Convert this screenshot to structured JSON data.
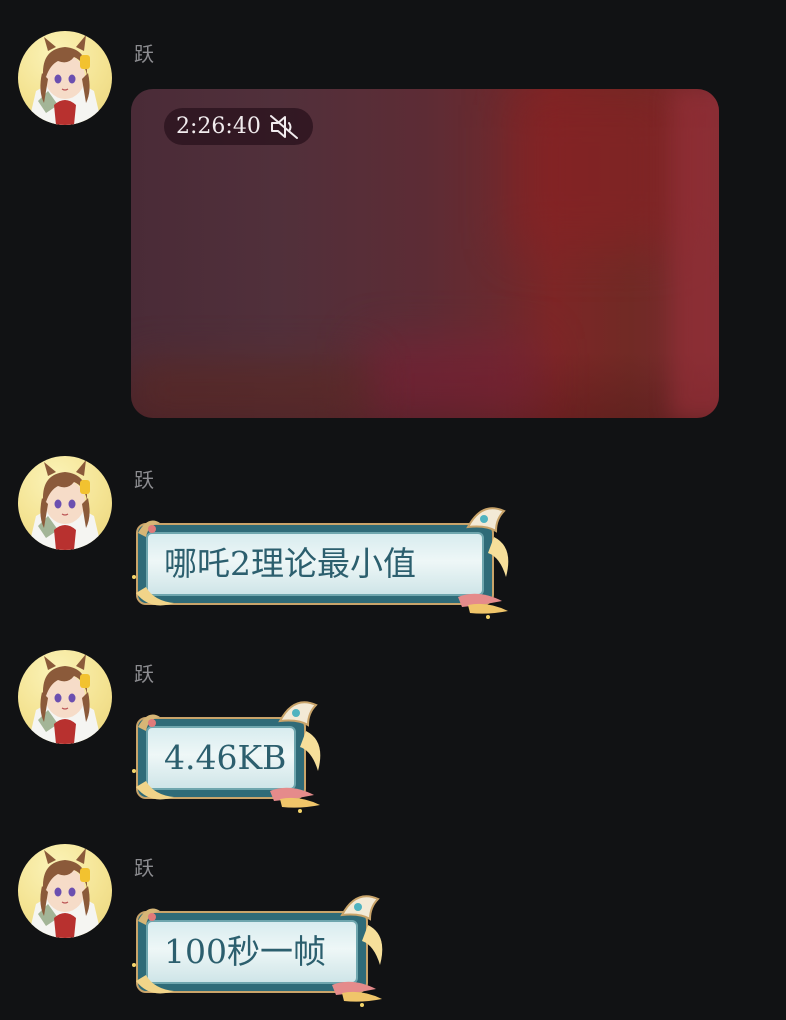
{
  "messages": [
    {
      "sender": "跃",
      "type": "video",
      "duration": "2:26:40",
      "muted_icon": "muted-speaker-icon"
    },
    {
      "sender": "跃",
      "type": "text",
      "text": "哪吒2理论最小值"
    },
    {
      "sender": "跃",
      "type": "text",
      "text": "4.46KB"
    },
    {
      "sender": "跃",
      "type": "text",
      "text": "100秒一帧"
    }
  ],
  "colors": {
    "background": "#111214",
    "sender_name": "#8c8c90",
    "bubble_text": "#2c5f6e",
    "bubble_frame": "#2f6b78",
    "bubble_gold": "#c9a46a",
    "avatar_bg": "#f4e392"
  }
}
